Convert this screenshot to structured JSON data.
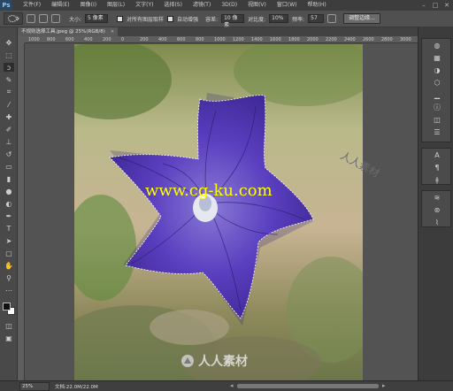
{
  "app": {
    "logo": "Ps"
  },
  "menu": [
    "文件(F)",
    "编辑(E)",
    "图像(I)",
    "图层(L)",
    "文字(Y)",
    "选择(S)",
    "滤镜(T)",
    "3D(D)",
    "视图(V)",
    "窗口(W)",
    "帮助(H)"
  ],
  "options": {
    "size_label": "大小:",
    "size_value": "5 像素",
    "sample_all_label": "对所有图层取样",
    "auto_enhance_label": "自动增强",
    "tolerance_label": "容差:",
    "tolerance_value": "10 像素",
    "contrast_label": "对比度:",
    "contrast_value": "10%",
    "frequency_label": "频率:",
    "frequency_value": "57",
    "refine_edge_button": "调整边缘..."
  },
  "document": {
    "tab_title": "不规则选择工具.jpeg @ 25%(RGB/8)",
    "close": "×"
  },
  "ruler_ticks": [
    "1000",
    "800",
    "600",
    "400",
    "200",
    "0",
    "200",
    "400",
    "600",
    "800",
    "1000",
    "1200",
    "1400",
    "1600",
    "1800",
    "2000",
    "2200",
    "2400",
    "2600",
    "2800",
    "3000"
  ],
  "image": {
    "watermark_url": "www.cg-ku.com",
    "watermark_brand": "人人素材",
    "watermark_brand_faint": "人人素材"
  },
  "status": {
    "zoom": "25%",
    "doc_info": "文档:22.0M/22.0M"
  },
  "colors": {
    "accent": "#2b4660",
    "flower": "#5a3fbf",
    "watermark": "#ffff00"
  }
}
